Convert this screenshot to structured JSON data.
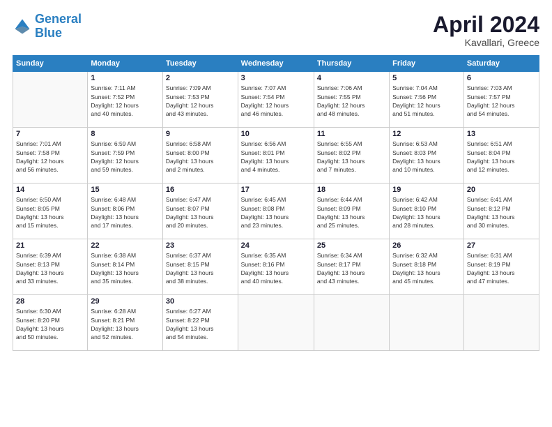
{
  "header": {
    "logo_line1": "General",
    "logo_line2": "Blue",
    "month": "April 2024",
    "location": "Kavallari, Greece"
  },
  "weekdays": [
    "Sunday",
    "Monday",
    "Tuesday",
    "Wednesday",
    "Thursday",
    "Friday",
    "Saturday"
  ],
  "weeks": [
    [
      {
        "day": "",
        "info": ""
      },
      {
        "day": "1",
        "info": "Sunrise: 7:11 AM\nSunset: 7:52 PM\nDaylight: 12 hours\nand 40 minutes."
      },
      {
        "day": "2",
        "info": "Sunrise: 7:09 AM\nSunset: 7:53 PM\nDaylight: 12 hours\nand 43 minutes."
      },
      {
        "day": "3",
        "info": "Sunrise: 7:07 AM\nSunset: 7:54 PM\nDaylight: 12 hours\nand 46 minutes."
      },
      {
        "day": "4",
        "info": "Sunrise: 7:06 AM\nSunset: 7:55 PM\nDaylight: 12 hours\nand 48 minutes."
      },
      {
        "day": "5",
        "info": "Sunrise: 7:04 AM\nSunset: 7:56 PM\nDaylight: 12 hours\nand 51 minutes."
      },
      {
        "day": "6",
        "info": "Sunrise: 7:03 AM\nSunset: 7:57 PM\nDaylight: 12 hours\nand 54 minutes."
      }
    ],
    [
      {
        "day": "7",
        "info": "Sunrise: 7:01 AM\nSunset: 7:58 PM\nDaylight: 12 hours\nand 56 minutes."
      },
      {
        "day": "8",
        "info": "Sunrise: 6:59 AM\nSunset: 7:59 PM\nDaylight: 12 hours\nand 59 minutes."
      },
      {
        "day": "9",
        "info": "Sunrise: 6:58 AM\nSunset: 8:00 PM\nDaylight: 13 hours\nand 2 minutes."
      },
      {
        "day": "10",
        "info": "Sunrise: 6:56 AM\nSunset: 8:01 PM\nDaylight: 13 hours\nand 4 minutes."
      },
      {
        "day": "11",
        "info": "Sunrise: 6:55 AM\nSunset: 8:02 PM\nDaylight: 13 hours\nand 7 minutes."
      },
      {
        "day": "12",
        "info": "Sunrise: 6:53 AM\nSunset: 8:03 PM\nDaylight: 13 hours\nand 10 minutes."
      },
      {
        "day": "13",
        "info": "Sunrise: 6:51 AM\nSunset: 8:04 PM\nDaylight: 13 hours\nand 12 minutes."
      }
    ],
    [
      {
        "day": "14",
        "info": "Sunrise: 6:50 AM\nSunset: 8:05 PM\nDaylight: 13 hours\nand 15 minutes."
      },
      {
        "day": "15",
        "info": "Sunrise: 6:48 AM\nSunset: 8:06 PM\nDaylight: 13 hours\nand 17 minutes."
      },
      {
        "day": "16",
        "info": "Sunrise: 6:47 AM\nSunset: 8:07 PM\nDaylight: 13 hours\nand 20 minutes."
      },
      {
        "day": "17",
        "info": "Sunrise: 6:45 AM\nSunset: 8:08 PM\nDaylight: 13 hours\nand 23 minutes."
      },
      {
        "day": "18",
        "info": "Sunrise: 6:44 AM\nSunset: 8:09 PM\nDaylight: 13 hours\nand 25 minutes."
      },
      {
        "day": "19",
        "info": "Sunrise: 6:42 AM\nSunset: 8:10 PM\nDaylight: 13 hours\nand 28 minutes."
      },
      {
        "day": "20",
        "info": "Sunrise: 6:41 AM\nSunset: 8:12 PM\nDaylight: 13 hours\nand 30 minutes."
      }
    ],
    [
      {
        "day": "21",
        "info": "Sunrise: 6:39 AM\nSunset: 8:13 PM\nDaylight: 13 hours\nand 33 minutes."
      },
      {
        "day": "22",
        "info": "Sunrise: 6:38 AM\nSunset: 8:14 PM\nDaylight: 13 hours\nand 35 minutes."
      },
      {
        "day": "23",
        "info": "Sunrise: 6:37 AM\nSunset: 8:15 PM\nDaylight: 13 hours\nand 38 minutes."
      },
      {
        "day": "24",
        "info": "Sunrise: 6:35 AM\nSunset: 8:16 PM\nDaylight: 13 hours\nand 40 minutes."
      },
      {
        "day": "25",
        "info": "Sunrise: 6:34 AM\nSunset: 8:17 PM\nDaylight: 13 hours\nand 43 minutes."
      },
      {
        "day": "26",
        "info": "Sunrise: 6:32 AM\nSunset: 8:18 PM\nDaylight: 13 hours\nand 45 minutes."
      },
      {
        "day": "27",
        "info": "Sunrise: 6:31 AM\nSunset: 8:19 PM\nDaylight: 13 hours\nand 47 minutes."
      }
    ],
    [
      {
        "day": "28",
        "info": "Sunrise: 6:30 AM\nSunset: 8:20 PM\nDaylight: 13 hours\nand 50 minutes."
      },
      {
        "day": "29",
        "info": "Sunrise: 6:28 AM\nSunset: 8:21 PM\nDaylight: 13 hours\nand 52 minutes."
      },
      {
        "day": "30",
        "info": "Sunrise: 6:27 AM\nSunset: 8:22 PM\nDaylight: 13 hours\nand 54 minutes."
      },
      {
        "day": "",
        "info": ""
      },
      {
        "day": "",
        "info": ""
      },
      {
        "day": "",
        "info": ""
      },
      {
        "day": "",
        "info": ""
      }
    ]
  ]
}
